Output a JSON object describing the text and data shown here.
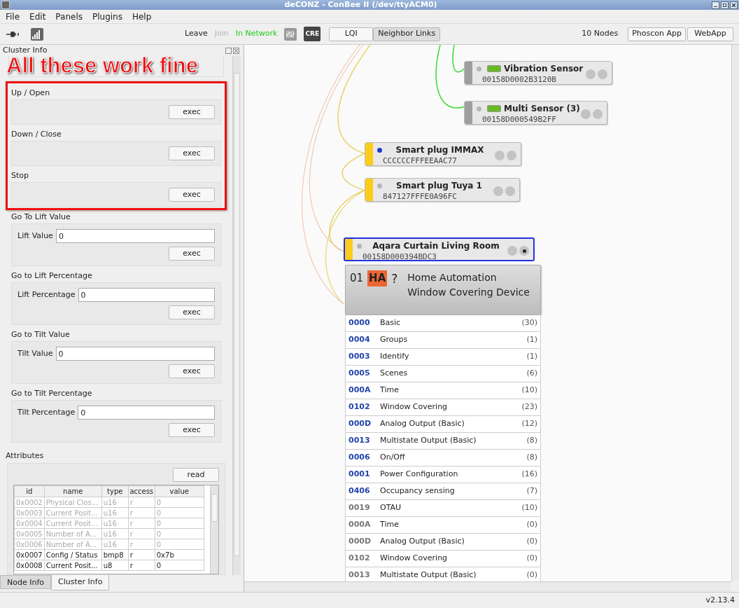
{
  "window": {
    "title": "deCONZ - ConBee II (/dev/ttyACM0)"
  },
  "menu": [
    "File",
    "Edit",
    "Panels",
    "Plugins",
    "Help"
  ],
  "toolbar": {
    "actions": [
      {
        "label": "Leave",
        "disabled": false,
        "active": false
      },
      {
        "label": "Join",
        "disabled": true,
        "active": false
      },
      {
        "label": "In Network",
        "disabled": false,
        "active": true
      }
    ],
    "badge": "CRE",
    "view_buttons": [
      {
        "label": "LQI",
        "selected": false
      },
      {
        "label": "Neighbor Links",
        "selected": true
      }
    ],
    "node_count": "10 Nodes",
    "app_buttons": [
      "Phoscon App",
      "WebApp"
    ]
  },
  "left_panel": {
    "title": "Cluster Info",
    "annotation": "All these work fine",
    "commands": [
      {
        "title": "Up / Open",
        "button": "exec"
      },
      {
        "title": "Down / Close",
        "button": "exec"
      },
      {
        "title": "Stop",
        "button": "exec"
      },
      {
        "title": "Go To Lift Value",
        "field_label": "Lift Value",
        "value": "0",
        "button": "exec"
      },
      {
        "title": "Go to Lift Percentage",
        "field_label": "Lift Percentage",
        "value": "0",
        "button": "exec"
      },
      {
        "title": "Go to Tilt Value",
        "field_label": "Tilt Value",
        "value": "0",
        "button": "exec"
      },
      {
        "title": "Go to Tilt Percentage",
        "field_label": "Tilt Percentage",
        "value": "0",
        "button": "exec"
      }
    ],
    "attributes": {
      "title": "Attributes",
      "button": "read",
      "columns": [
        "id",
        "name",
        "type",
        "access",
        "value"
      ],
      "rows": [
        {
          "cells": [
            "0x0002",
            "Physical Clos...",
            "u16",
            "r",
            "0"
          ],
          "disabled": true
        },
        {
          "cells": [
            "0x0003",
            "Current Posit...",
            "u16",
            "r",
            "0"
          ],
          "disabled": true
        },
        {
          "cells": [
            "0x0004",
            "Current Posit...",
            "u16",
            "r",
            "0"
          ],
          "disabled": true
        },
        {
          "cells": [
            "0x0005",
            "Number of A...",
            "u16",
            "r",
            "0"
          ],
          "disabled": true
        },
        {
          "cells": [
            "0x0006",
            "Number of A...",
            "u16",
            "r",
            "0"
          ],
          "disabled": true
        },
        {
          "cells": [
            "0x0007",
            "Config / Status",
            "bmp8",
            "r",
            "0x7b"
          ],
          "disabled": false
        },
        {
          "cells": [
            "0x0008",
            "Current Posit...",
            "u8",
            "r",
            "0"
          ],
          "disabled": false
        }
      ]
    }
  },
  "bottom_tabs": [
    {
      "label": "Node Info",
      "selected": false
    },
    {
      "label": "Cluster Info",
      "selected": true
    }
  ],
  "nodes": [
    {
      "name": "Vibration Sensor",
      "address": "00158D0002B3120B",
      "color": "#9e9e9e",
      "battery": true,
      "dot_active": false,
      "selected": false,
      "endpoint_selected": false
    },
    {
      "name": "Multi Sensor (3)",
      "address": "00158D000549B2FF",
      "color": "#9e9e9e",
      "battery": true,
      "dot_active": false,
      "selected": false,
      "endpoint_selected": false
    },
    {
      "name": "Smart plug IMMAX",
      "address": "CCCCCCFFFEEAAC77",
      "color": "#fccc1a",
      "battery": false,
      "dot_active": true,
      "selected": false,
      "endpoint_selected": false
    },
    {
      "name": "Smart plug Tuya 1",
      "address": "847127FFFE0A96FC",
      "color": "#fccc1a",
      "battery": false,
      "dot_active": false,
      "selected": false,
      "endpoint_selected": false
    },
    {
      "name": "Aqara Curtain Living Room",
      "address": "00158D000394BDC3",
      "color": "#fccc1a",
      "battery": false,
      "dot_active": false,
      "selected": true,
      "endpoint_selected": true
    }
  ],
  "endpoint": {
    "number": "01",
    "profile": "HA",
    "mark": "?",
    "profile_name": "Home Automation",
    "device": "Window Covering Device",
    "clusters": [
      {
        "id": "0000",
        "name": "Basic",
        "count": "(30)",
        "server_side": true
      },
      {
        "id": "0004",
        "name": "Groups",
        "count": "(1)",
        "server_side": true
      },
      {
        "id": "0003",
        "name": "Identify",
        "count": "(1)",
        "server_side": true
      },
      {
        "id": "0005",
        "name": "Scenes",
        "count": "(6)",
        "server_side": true
      },
      {
        "id": "000A",
        "name": "Time",
        "count": "(10)",
        "server_side": true
      },
      {
        "id": "0102",
        "name": "Window Covering",
        "count": "(23)",
        "server_side": true
      },
      {
        "id": "000D",
        "name": "Analog Output (Basic)",
        "count": "(12)",
        "server_side": true
      },
      {
        "id": "0013",
        "name": "Multistate Output (Basic)",
        "count": "(8)",
        "server_side": true
      },
      {
        "id": "0006",
        "name": "On/Off",
        "count": "(8)",
        "server_side": true
      },
      {
        "id": "0001",
        "name": "Power Configuration",
        "count": "(16)",
        "server_side": true
      },
      {
        "id": "0406",
        "name": "Occupancy sensing",
        "count": "(7)",
        "server_side": true
      },
      {
        "id": "0019",
        "name": "OTAU",
        "count": "(10)",
        "server_side": false
      },
      {
        "id": "000A",
        "name": "Time",
        "count": "(0)",
        "server_side": false
      },
      {
        "id": "000D",
        "name": "Analog Output (Basic)",
        "count": "(0)",
        "server_side": false
      },
      {
        "id": "0102",
        "name": "Window Covering",
        "count": "(0)",
        "server_side": false
      },
      {
        "id": "0013",
        "name": "Multistate Output (Basic)",
        "count": "(0)",
        "server_side": false
      }
    ]
  },
  "status_bar": {
    "version": "v2.13.4"
  }
}
